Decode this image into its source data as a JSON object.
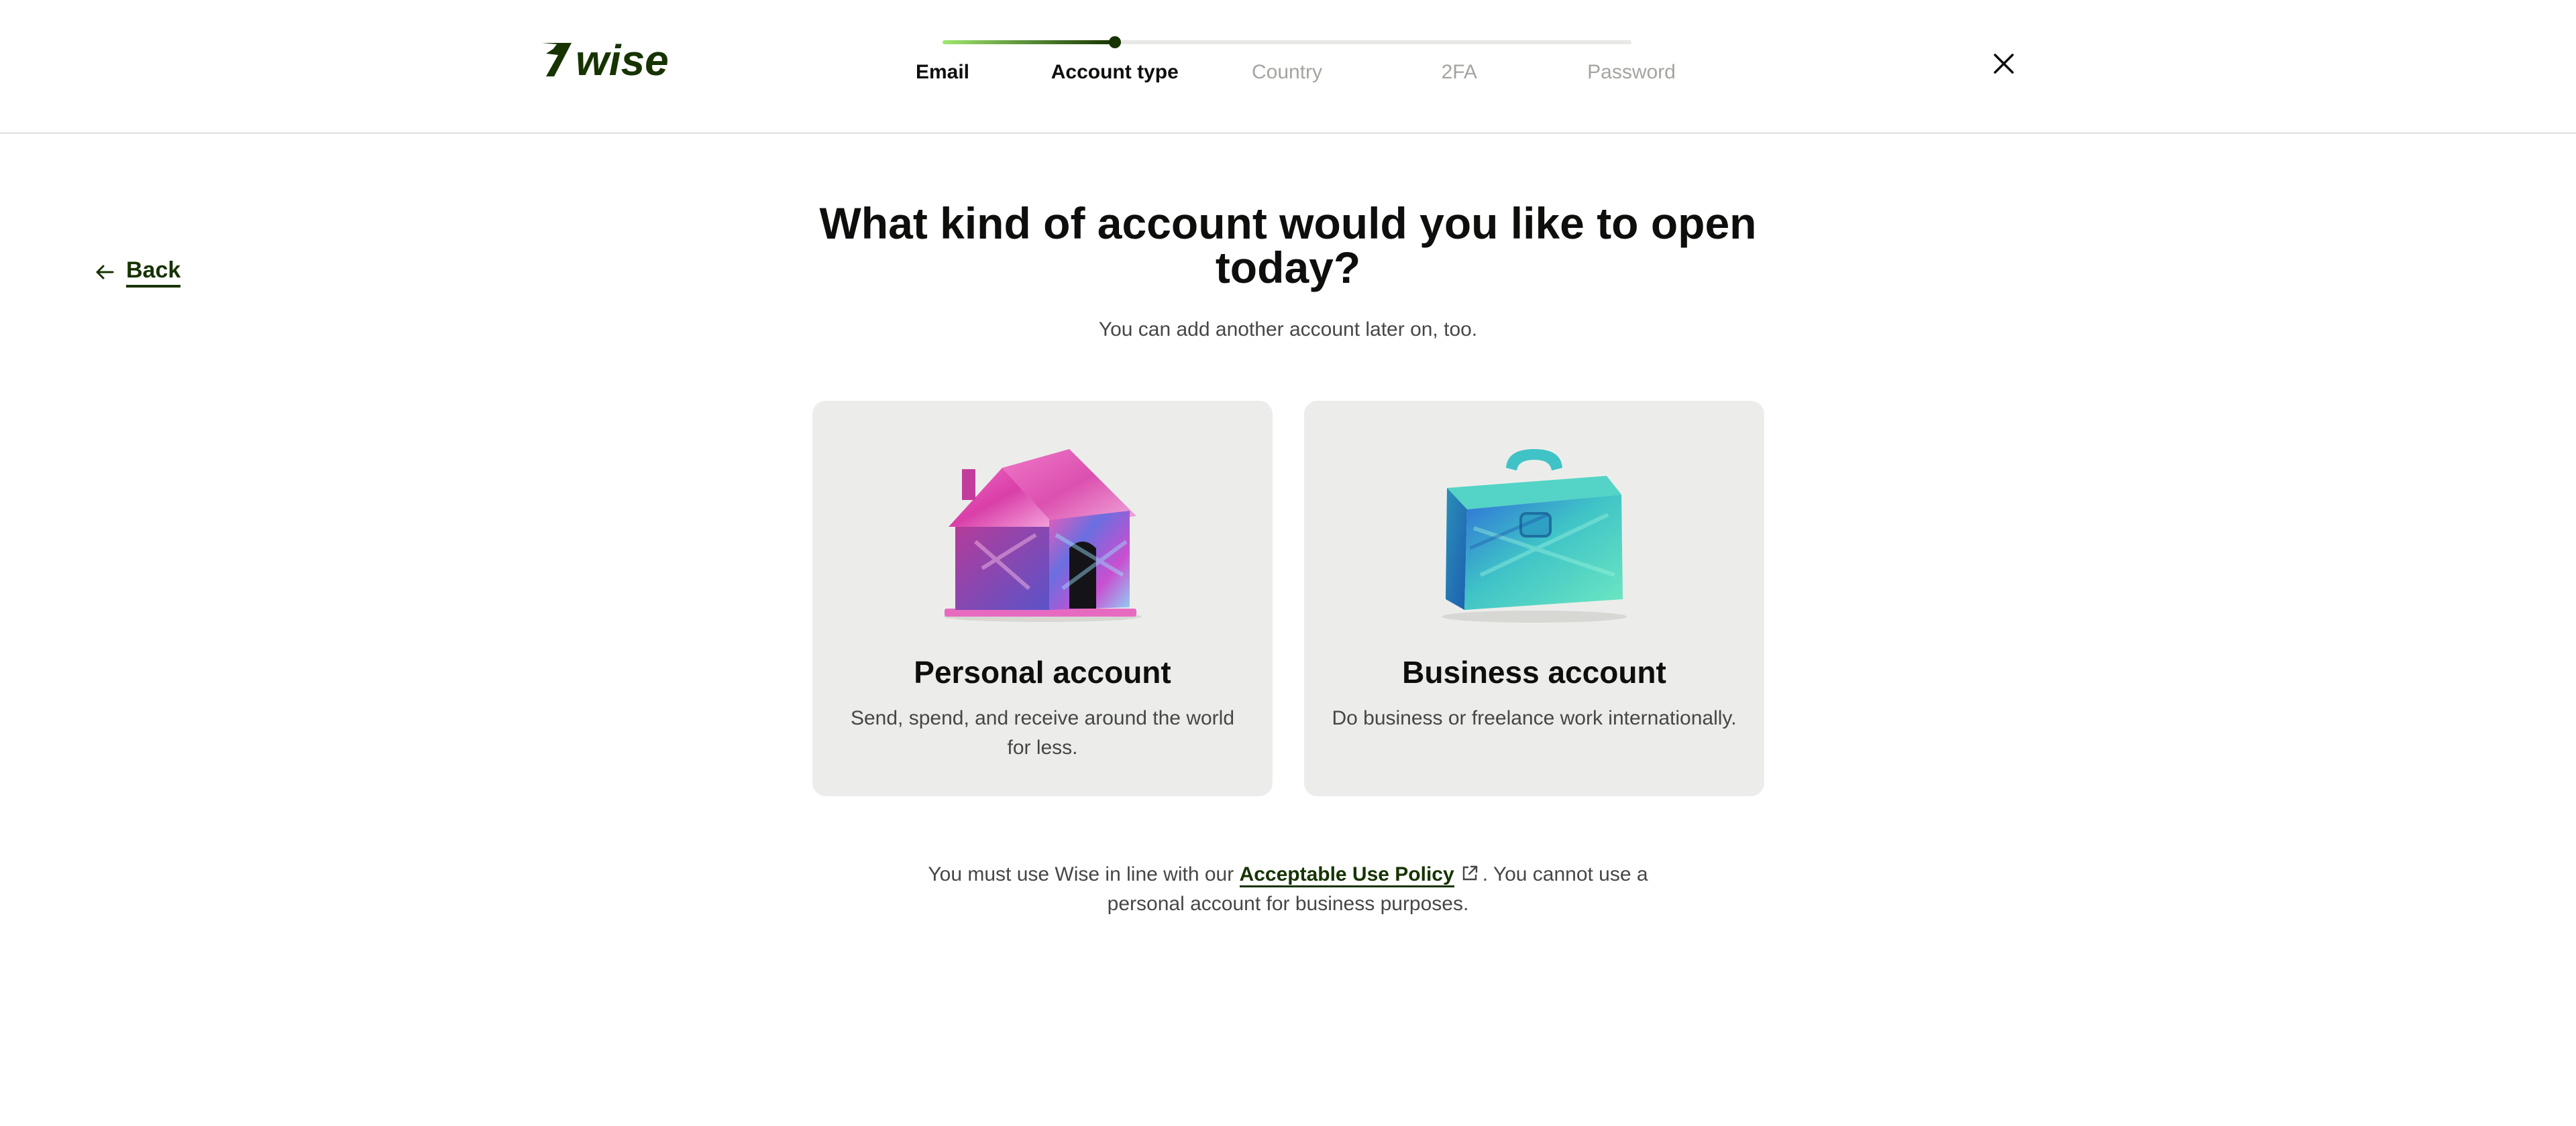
{
  "brand": {
    "name": "Wise",
    "logo_icon": "wise-flag-logo",
    "primary_green": "#163300",
    "accent_green": "#9fe870"
  },
  "stepper": {
    "steps": [
      {
        "label": "Email",
        "state": "done"
      },
      {
        "label": "Account type",
        "state": "active"
      },
      {
        "label": "Country",
        "state": "upcoming"
      },
      {
        "label": "2FA",
        "state": "upcoming"
      },
      {
        "label": "Password",
        "state": "upcoming"
      }
    ],
    "progress_fraction": 0.25
  },
  "header": {
    "close_icon": "close-icon"
  },
  "back": {
    "label": "Back",
    "icon": "arrow-left-icon"
  },
  "main": {
    "title": "What kind of account would you like to open today?",
    "subtitle": "You can add another account later on, too."
  },
  "options": [
    {
      "id": "personal",
      "title": "Personal account",
      "description": "Send, spend, and receive around the world for less.",
      "illustration": "house-illustration"
    },
    {
      "id": "business",
      "title": "Business account",
      "description": "Do business or freelance work internationally.",
      "illustration": "briefcase-illustration"
    }
  ],
  "policy": {
    "before": "You must use Wise in line with our ",
    "link": "Acceptable Use Policy",
    "after": ". You cannot use a personal account for business purposes.",
    "link_icon": "external-link-icon"
  }
}
